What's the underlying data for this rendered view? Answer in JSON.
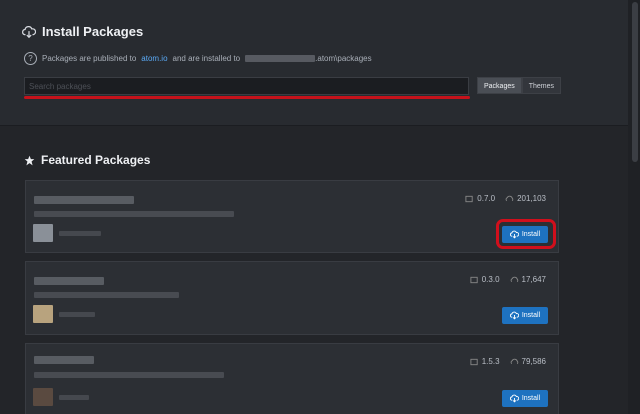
{
  "install": {
    "title": "Install Packages",
    "info_prefix": "Packages are published to",
    "info_link": "atom.io",
    "info_mid": "and are installed to",
    "info_suffix": ".atom\\packages",
    "search_placeholder": "Search packages",
    "toggles": [
      "Packages",
      "Themes"
    ],
    "active_toggle": "Packages"
  },
  "featured": {
    "title": "Featured Packages",
    "install_label": "Install",
    "cards": [
      {
        "version": "0.7.0",
        "downloads": "201,103"
      },
      {
        "version": "0.3.0",
        "downloads": "17,647"
      },
      {
        "version": "1.5.3",
        "downloads": "79,586"
      }
    ]
  },
  "colors": {
    "accent": "#1e72c0",
    "highlight": "#d10f1c"
  }
}
